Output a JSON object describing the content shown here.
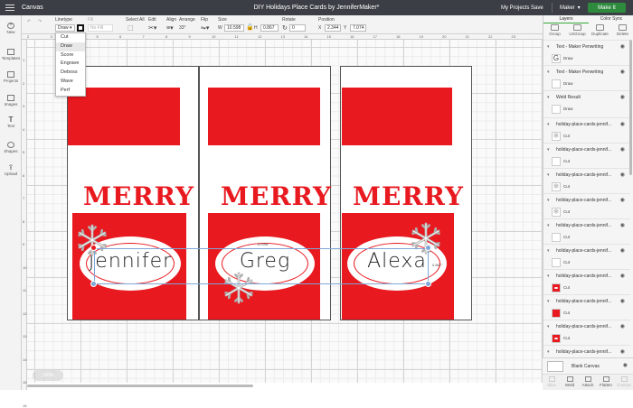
{
  "app": {
    "menu_label": "Canvas",
    "project_title": "DIY Holidays Place Cards by JenniferMaker*",
    "my_projects": "My Projects",
    "save": "Save",
    "machine": "Maker",
    "make_it": "Make It"
  },
  "toolbar": {
    "linetype_label": "Linetype",
    "linetype_value": "Draw",
    "fill_label": "Fill",
    "fill_value": "No Fill",
    "select_all": "Select All",
    "edit": "Edit",
    "align": "Align",
    "arrange": "Arrange",
    "flip": "Flip",
    "size_label": "Size",
    "size_w_label": "W",
    "size_w": "10.598",
    "size_h_label": "H",
    "size_h": "0.867",
    "rotate_label": "Rotate",
    "rotate_value": "0",
    "position_label": "Position",
    "pos_x_label": "X",
    "pos_x": "2.344",
    "pos_y_label": "Y",
    "pos_y": "7.074",
    "arrange_value": "33°"
  },
  "linetype_menu": [
    "Cut",
    "Draw",
    "Score",
    "Engrave",
    "Deboss",
    "Wave",
    "Perf"
  ],
  "linetype_selected": "Draw",
  "leftbar": [
    "New",
    "Templates",
    "Projects",
    "Images",
    "Text",
    "Shapes",
    "Upload"
  ],
  "ruler_top": [
    "2",
    "3",
    "4",
    "5",
    "6",
    "7",
    "8",
    "9",
    "10",
    "11",
    "12",
    "13",
    "14",
    "15",
    "16",
    "17",
    "18",
    "19",
    "20",
    "21",
    "22",
    "23"
  ],
  "ruler_left": [
    "1",
    "2",
    "3",
    "4",
    "5",
    "6",
    "7",
    "8",
    "9",
    "10",
    "11",
    "12",
    "13",
    "14",
    "15",
    "16"
  ],
  "cards": [
    {
      "merry": "MERRY",
      "name": "Jennifer"
    },
    {
      "merry": "MERRY",
      "name": "Greg"
    },
    {
      "merry": "MERRY",
      "name": "Alexa"
    }
  ],
  "dimensions": {
    "width": "10.598\"",
    "height": "0.867\""
  },
  "zoom": "100%",
  "panel": {
    "tab_layers": "Layers",
    "tab_color_sync": "Color Sync",
    "tools": [
      "Group",
      "UnGroup",
      "Duplicate",
      "Delete"
    ],
    "layers": [
      {
        "title": "Text - Maker Penwriting",
        "op": "Draw",
        "thumb": "G"
      },
      {
        "title": "Text - Maker Penwriting",
        "op": "Draw",
        "thumb": ""
      },
      {
        "title": "Weld Result",
        "op": "Draw",
        "thumb": ""
      },
      {
        "title": "holiday-place-cards-jennif...",
        "op": "Cut",
        "thumb": "flake"
      },
      {
        "title": "holiday-place-cards-jennif...",
        "op": "Cut",
        "thumb": ""
      },
      {
        "title": "holiday-place-cards-jennif...",
        "op": "Cut",
        "thumb": "flake"
      },
      {
        "title": "holiday-place-cards-jennif...",
        "op": "Cut",
        "thumb": "flake"
      },
      {
        "title": "holiday-place-cards-jennif...",
        "op": "Cut",
        "thumb": ""
      },
      {
        "title": "holiday-place-cards-jennif...",
        "op": "Cut",
        "thumb": ""
      },
      {
        "title": "holiday-place-cards-jennif...",
        "op": "Cut",
        "thumb": "red-oval"
      },
      {
        "title": "holiday-place-cards-jennif...",
        "op": "Cut",
        "thumb": "red"
      },
      {
        "title": "holiday-place-cards-jennif...",
        "op": "Cut",
        "thumb": "red-oval"
      },
      {
        "title": "holiday-place-cards-jennif...",
        "op": "Cut",
        "thumb": "red"
      }
    ],
    "blank_canvas": "Blank Canvas",
    "bottom_tools": [
      "Slice",
      "Weld",
      "Attach",
      "Flatten",
      "Contour"
    ]
  },
  "colors": {
    "card_red": "#e8191f",
    "topbar": "#3b3f45",
    "make_it": "#2e8b3e"
  }
}
